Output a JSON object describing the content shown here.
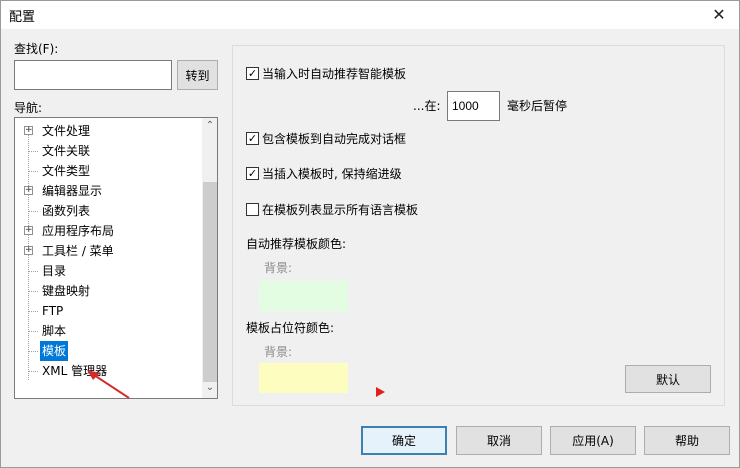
{
  "window": {
    "title": "配置",
    "close_glyph": "✕"
  },
  "search": {
    "label": "查找(F):",
    "value": "",
    "goto_button": "转到"
  },
  "navigation": {
    "label": "导航:",
    "items": [
      {
        "label": "文件处理",
        "expandable": true
      },
      {
        "label": "文件关联",
        "expandable": false
      },
      {
        "label": "文件类型",
        "expandable": false
      },
      {
        "label": "编辑器显示",
        "expandable": true
      },
      {
        "label": "函数列表",
        "expandable": false
      },
      {
        "label": "应用程序布局",
        "expandable": true
      },
      {
        "label": "工具栏 / 菜单",
        "expandable": true
      },
      {
        "label": "目录",
        "expandable": false
      },
      {
        "label": "键盘映射",
        "expandable": false
      },
      {
        "label": "FTP",
        "expandable": false
      },
      {
        "label": "脚本",
        "expandable": false
      },
      {
        "label": "模板",
        "expandable": false,
        "selected": true
      },
      {
        "label": "XML 管理器",
        "expandable": false
      }
    ],
    "expander_glyph": "+",
    "scroll_up_glyph": "⌃",
    "scroll_down_glyph": "⌄"
  },
  "template_settings": {
    "auto_suggest": {
      "label": "当输入时自动推荐智能模板",
      "checked": true,
      "check_glyph": "✓"
    },
    "delay": {
      "prefix": "...在:",
      "value": "1000",
      "suffix": "毫秒后暂停"
    },
    "include_in_autocomplete": {
      "label": "包含模板到自动完成对话框",
      "checked": true,
      "check_glyph": "✓"
    },
    "keep_indent": {
      "label": "当插入模板时, 保持缩进级",
      "checked": true,
      "check_glyph": "✓"
    },
    "show_all_languages": {
      "label": "在模板列表显示所有语言模板",
      "checked": false,
      "check_glyph": ""
    },
    "suggest_color": {
      "label": "自动推荐模板颜色:",
      "background_label": "背景:",
      "color": "#e2fde1"
    },
    "placeholder_color": {
      "label": "模板占位符颜色:",
      "background_label": "背景:",
      "color": "#fdfdbf"
    },
    "default_button": "默认"
  },
  "footer": {
    "ok_button": "确定",
    "cancel_button": "取消",
    "apply_button": "应用(A)",
    "help_button": "帮助"
  },
  "colors": {
    "selection": "#0078d7",
    "primary_border": "#3c7fb1"
  }
}
